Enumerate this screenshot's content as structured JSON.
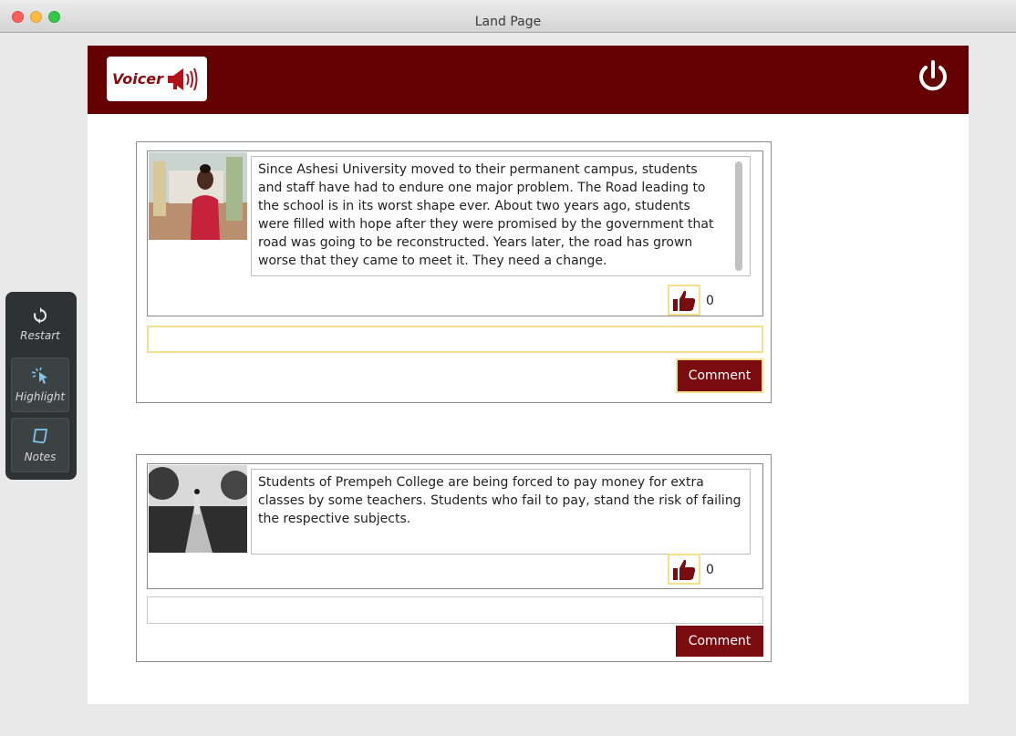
{
  "window": {
    "title": "Land Page"
  },
  "header": {
    "logo_text": "Voicer",
    "logo_icon": "megaphone-icon",
    "power_icon": "power-icon"
  },
  "toolbar": {
    "items": [
      {
        "label": "Restart",
        "icon": "restart-icon"
      },
      {
        "label": "Highlight",
        "icon": "cursor-click-icon"
      },
      {
        "label": "Notes",
        "icon": "note-icon"
      }
    ]
  },
  "posts": [
    {
      "text": "Since Ashesi University moved to their permanent campus, students and staff have had to endure one major problem. The Road leading to the school is in its worst shape ever. About two years ago, students were filled with hope after they were promised by the government that road was going to be reconstructed. Years later, the road has grown worse that they came to meet it. They need a change.",
      "likes": "0",
      "comment_label": "Comment",
      "comment_value": ""
    },
    {
      "text": "Students of Prempeh College are being forced to pay money for extra classes by some teachers. Students who fail to pay, stand the risk of failing the respective subjects.",
      "likes": "0",
      "comment_label": "Comment",
      "comment_value": ""
    }
  ],
  "colors": {
    "brand": "#640001",
    "button": "#7a0b0f",
    "highlight": "#f4e08a"
  }
}
